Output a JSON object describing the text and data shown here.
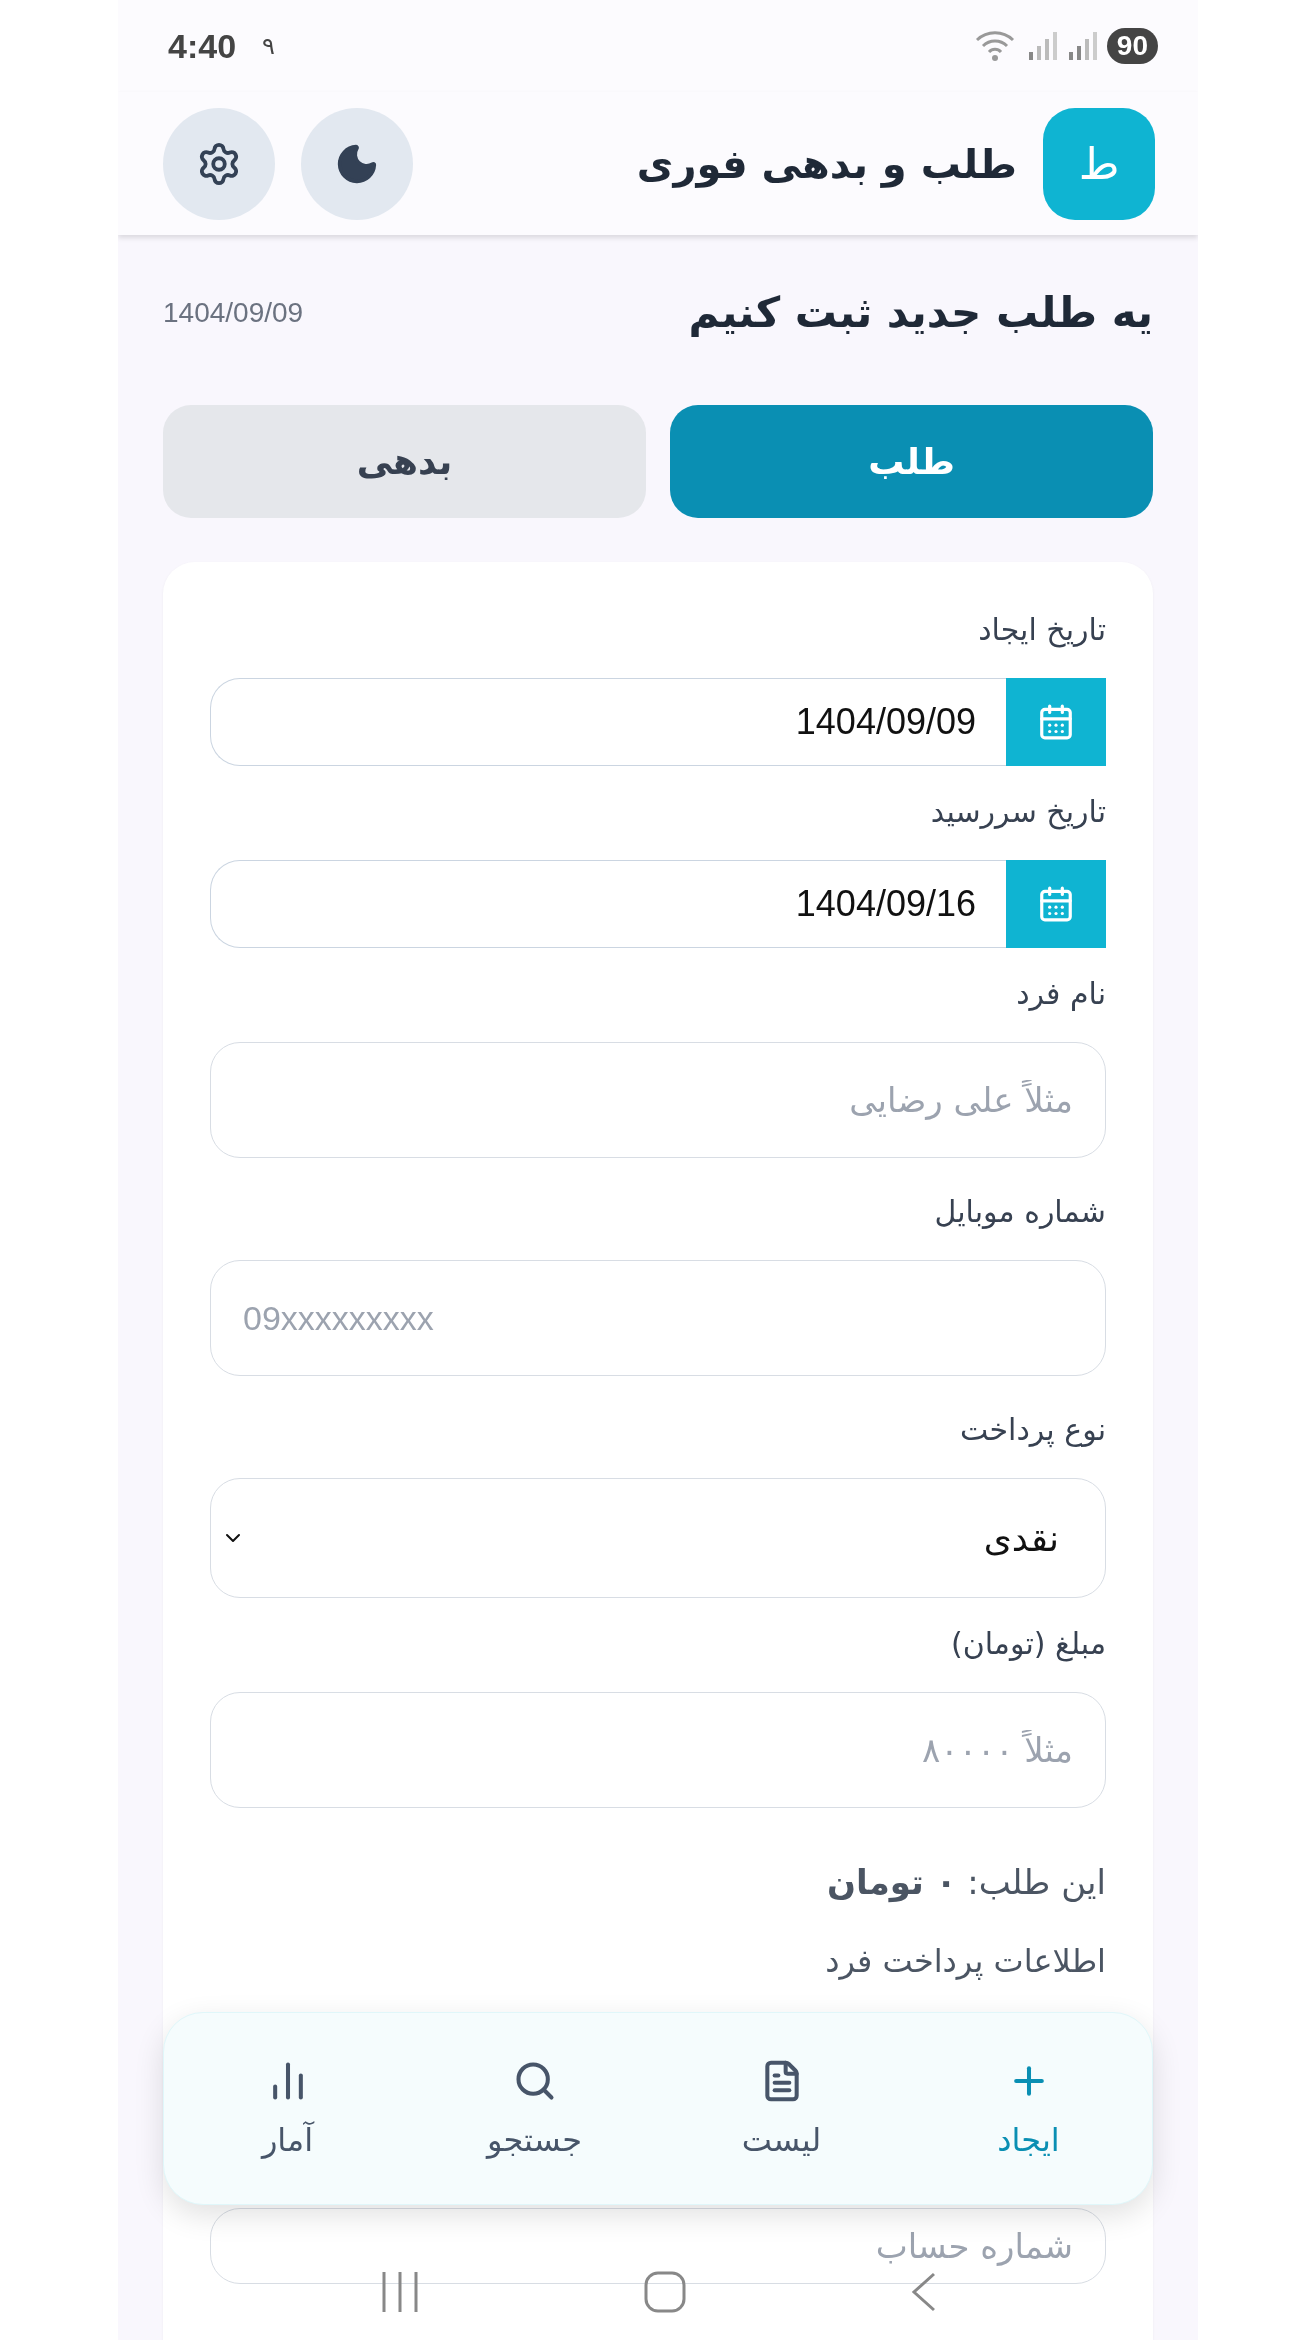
{
  "status_bar": {
    "time": "4:40",
    "notification": "۹",
    "battery": "90"
  },
  "header": {
    "logo": "ط",
    "title": "طلب و بدهی فوری"
  },
  "page": {
    "heading": "یه طلب جدید ثبت کنیم",
    "date": "1404/09/09"
  },
  "tabs": [
    {
      "label": "طلب",
      "selected": true
    },
    {
      "label": "بدهی",
      "selected": false
    }
  ],
  "form": {
    "fields": [
      {
        "kind": "date",
        "label": "تاریخ ایجاد",
        "value": "1404/09/09"
      },
      {
        "kind": "date",
        "label": "تاریخ سررسید",
        "value": "1404/09/16"
      },
      {
        "kind": "text",
        "label": "نام فرد",
        "placeholder": "مثلاً علی رضایی"
      },
      {
        "kind": "phone",
        "label": "شماره موبایل",
        "placeholder": "09xxxxxxxxx"
      },
      {
        "kind": "select",
        "label": "نوع پرداخت",
        "value": "نقدی"
      },
      {
        "kind": "text",
        "label": "مبلغ (تومان)",
        "placeholder": "مثلاً ۸۰۰۰۰"
      }
    ],
    "total": "این طلب: **۰ تومان**",
    "payment_info": {
      "label": "اطلاعات پرداخت فرد",
      "fields": [
        {
          "kind": "text",
          "placeholder": "شماره حساب"
        }
      ]
    }
  },
  "bottom_nav": [
    {
      "label": "ایجاد",
      "selected": true
    },
    {
      "label": "لیست",
      "selected": false
    },
    {
      "label": "جستجو",
      "selected": false
    },
    {
      "label": "آمار",
      "selected": false
    }
  ]
}
